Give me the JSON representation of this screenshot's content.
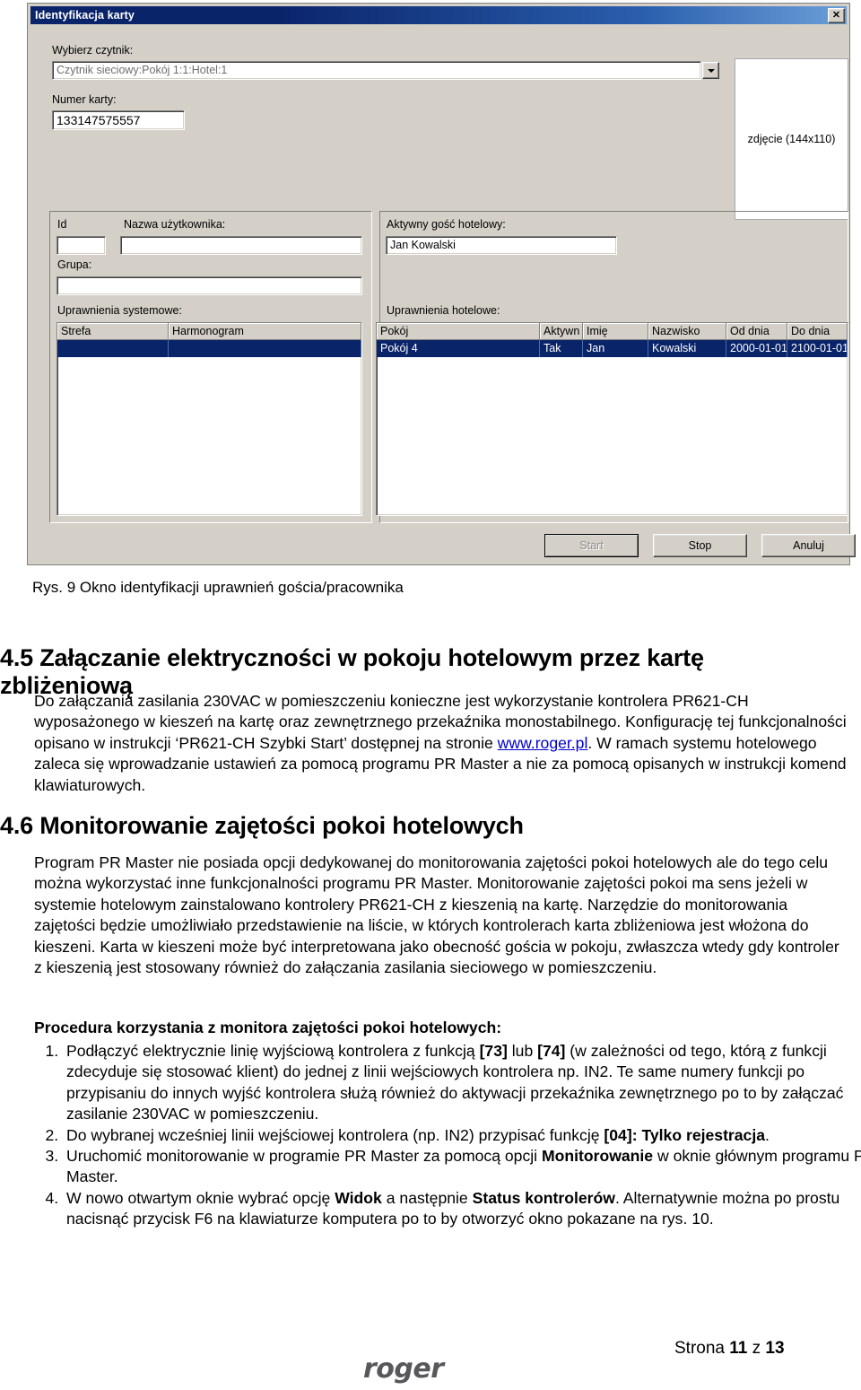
{
  "dialog": {
    "title": "Identyfikacja karty",
    "close_label": "✕",
    "reader_label": "Wybierz czytnik:",
    "reader_value": "Czytnik sieciowy:Pokój 1:1:Hotel:1",
    "card_label": "Numer karty:",
    "card_value": "133147575557",
    "photo_placeholder": "zdjęcie (144x110)",
    "id_label": "Id",
    "id_value": "",
    "username_label": "Nazwa użytkownika:",
    "username_value": "",
    "group_label": "Grupa:",
    "group_value": "",
    "system_perms_label": "Uprawnienia systemowe:",
    "active_guest_label": "Aktywny gość hotelowy:",
    "active_guest_value": "Jan Kowalski",
    "hotel_perms_label": "Uprawnienia hotelowe:",
    "system_table": {
      "columns": [
        "Strefa",
        "Harmonogram"
      ],
      "rows": [
        [
          "",
          ""
        ]
      ]
    },
    "hotel_table": {
      "columns": [
        "Pokój",
        "Aktywn",
        "Imię",
        "Nazwisko",
        "Od dnia",
        "Do dnia"
      ],
      "rows": [
        [
          "Pokój 4",
          "Tak",
          "Jan",
          "Kowalski",
          "2000-01-01",
          "2100-01-01"
        ]
      ]
    },
    "buttons": {
      "start": "Start",
      "stop": "Stop",
      "cancel": "Anuluj"
    }
  },
  "document": {
    "figure_caption": "Rys. 9 Okno identyfikacji uprawnień gościa/pracownika",
    "section_45_title": "4.5 Załączanie elektryczności w pokoju hotelowym przez kartę zbliżeniową",
    "section_45_para_1": "Do załączania zasilania 230VAC w pomieszczeniu konieczne jest wykorzystanie kontrolera PR621-CH wyposażonego w kieszeń na kartę oraz zewnętrznego przekaźnika monostabilnego. Konfigurację tej funkcjonalności opisano w instrukcji ‘PR621-CH Szybki Start’ dostępnej na stronie ",
    "section_45_link": "www.roger.pl",
    "section_45_para_2": ". W ramach systemu hotelowego zaleca się wprowadzanie ustawień za pomocą programu PR Master a nie za pomocą opisanych w instrukcji komend klawiaturowych.",
    "section_46_title": "4.6 Monitorowanie zajętości pokoi hotelowych",
    "section_46_para": "Program PR Master nie posiada opcji dedykowanej do monitorowania zajętości pokoi hotelowych ale do tego celu można wykorzystać inne funkcjonalności programu PR Master. Monitorowanie zajętości pokoi ma sens jeżeli w systemie hotelowym zainstalowano kontrolery PR621-CH z kieszenią na kartę. Narzędzie do monitorowania zajętości będzie umożliwiało przedstawienie na liście, w których kontrolerach karta zbliżeniowa jest włożona do kieszeni. Karta w kieszeni może być interpretowana jako obecność gościa w pokoju, zwłaszcza wtedy gdy kontroler z kieszenią jest stosowany również do załączania zasilania sieciowego w pomieszczeniu.",
    "procedure_label": "Procedura korzystania z monitora zajętości pokoi hotelowych:",
    "step_1_a": "Podłączyć elektrycznie linię wyjściową kontrolera z funkcją ",
    "step_1_b73": "[73]",
    "step_1_c": " lub ",
    "step_1_b74": "[74]",
    "step_1_d": " (w zależności od tego, którą z funkcji zdecyduje się stosować klient) do jednej z linii wejściowych kontrolera np. IN2. Te same numery funkcji po przypisaniu do innych wyjść kontrolera służą również do aktywacji przekaźnika zewnętrznego po to by załączać zasilanie 230VAC w pomieszczeniu.",
    "step_2_a": "Do wybranej wcześniej linii wejściowej kontrolera (np. IN2) przypisać funkcję ",
    "step_2_b": "[04]: Tylko rejestracja",
    "step_2_c": ".",
    "step_3_a": "Uruchomić monitorowanie w programie PR Master za pomocą opcji ",
    "step_3_b": "Monitorowanie",
    "step_3_c": " w oknie głównym programu PR Master.",
    "step_4_a": "W nowo otwartym oknie wybrać opcję ",
    "step_4_b": "Widok",
    "step_4_c": " a następnie ",
    "step_4_d": "Status kontrolerów",
    "step_4_e": ". Alternatywnie można po prostu nacisnąć przycisk F6 na klawiaturze komputera po to by otworzyć okno pokazane na rys. 10."
  },
  "footer": {
    "logo": "roger",
    "page_prefix": "Strona ",
    "page_current": "11",
    "page_mid": " z ",
    "page_total": "13"
  },
  "colors": {
    "titlebar": "#0a246a",
    "selection": "#0a246a",
    "dialog_face": "#d4d0c8",
    "link": "#0000cc",
    "logo": "#58585a"
  }
}
